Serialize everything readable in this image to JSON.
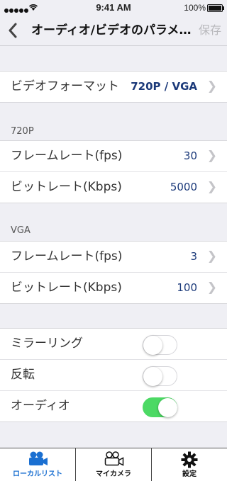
{
  "status": {
    "time": "9:41 AM",
    "battery": "100%"
  },
  "nav": {
    "title": "オーディオ/ビデオのパラメ…",
    "save": "保存"
  },
  "format": {
    "label": "ビデオフォーマット",
    "value": "720P / VGA"
  },
  "section720": {
    "header": "720P",
    "fps_label": "フレームレート(fps)",
    "fps_value": "30",
    "bitrate_label": "ビットレート(Kbps)",
    "bitrate_value": "5000"
  },
  "sectionVGA": {
    "header": "VGA",
    "fps_label": "フレームレート(fps)",
    "fps_value": "3",
    "bitrate_label": "ビットレート(Kbps)",
    "bitrate_value": "100"
  },
  "toggles": {
    "mirroring": {
      "label": "ミラーリング",
      "on": false
    },
    "flip": {
      "label": "反転",
      "on": false
    },
    "audio": {
      "label": "オーディオ",
      "on": true
    }
  },
  "tabs": {
    "local": "ローカルリスト",
    "camera": "マイカメラ",
    "settings": "設定"
  },
  "colors": {
    "accent": "#1a6fd1",
    "value": "#1c3a7a",
    "toggle_on": "#4cd964"
  }
}
